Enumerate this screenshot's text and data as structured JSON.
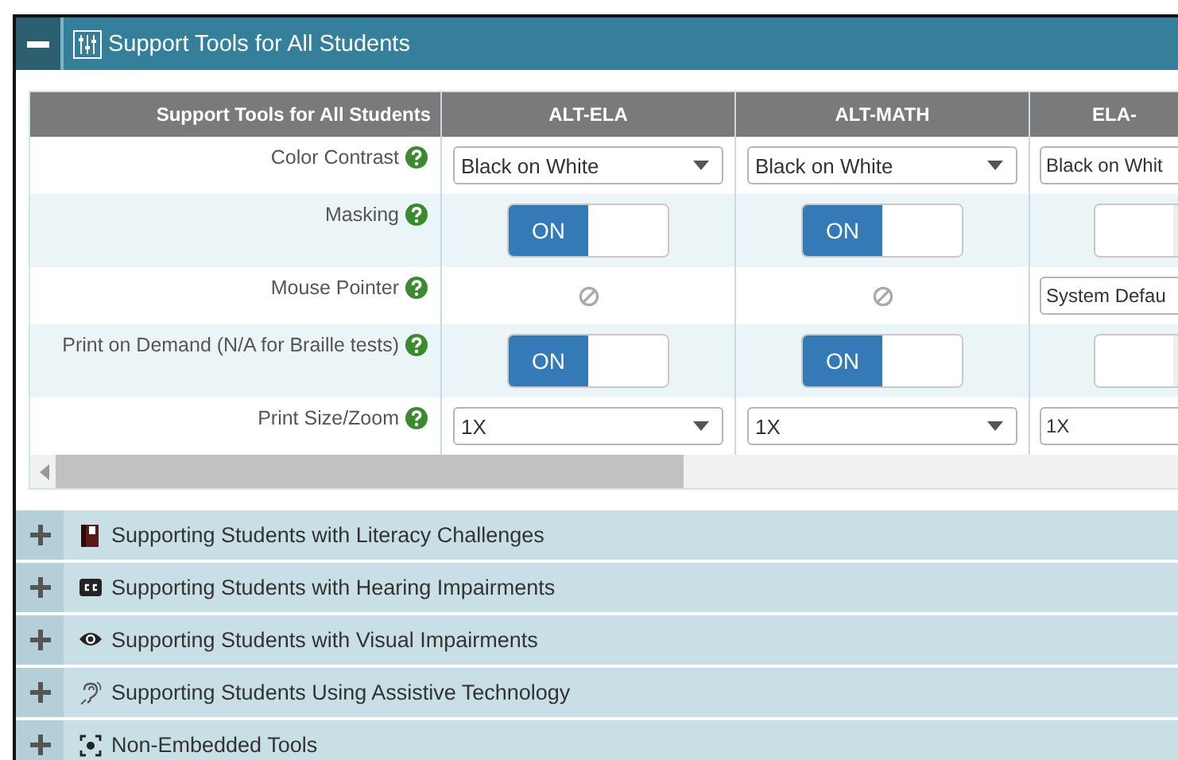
{
  "panel": {
    "title": "Support Tools for All Students",
    "expanded": true
  },
  "table": {
    "columns": [
      "Support Tools for All Students",
      "ALT-ELA",
      "ALT-MATH",
      "ELA-"
    ],
    "rows": [
      {
        "cells": [
          {
            "kind": "label",
            "text": "Color Contrast"
          },
          {
            "kind": "select",
            "value": "Black on White"
          },
          {
            "kind": "select",
            "value": "Black on White"
          },
          {
            "kind": "select",
            "value": "Black on Whit"
          }
        ]
      },
      {
        "cells": [
          {
            "kind": "label",
            "text": "Masking"
          },
          {
            "kind": "toggle",
            "on": true,
            "label": "ON"
          },
          {
            "kind": "toggle",
            "on": true,
            "label": "ON"
          },
          {
            "kind": "toggle",
            "on": false
          }
        ]
      },
      {
        "cells": [
          {
            "kind": "label",
            "text": "Mouse Pointer"
          },
          {
            "kind": "unavailable"
          },
          {
            "kind": "unavailable"
          },
          {
            "kind": "select",
            "value": "System Defau"
          }
        ]
      },
      {
        "cells": [
          {
            "kind": "label",
            "text": "Print on Demand (N/A for Braille tests)"
          },
          {
            "kind": "toggle",
            "on": true,
            "label": "ON"
          },
          {
            "kind": "toggle",
            "on": true,
            "label": "ON"
          },
          {
            "kind": "toggle",
            "on": false
          }
        ]
      },
      {
        "cells": [
          {
            "kind": "label",
            "text": "Print Size/Zoom"
          },
          {
            "kind": "select",
            "value": "1X"
          },
          {
            "kind": "select",
            "value": "1X"
          },
          {
            "kind": "select",
            "value": "1X"
          }
        ]
      }
    ]
  },
  "sections": [
    {
      "title": "Supporting Students with Literacy Challenges",
      "expanded": false
    },
    {
      "title": "Supporting Students with Hearing Impairments",
      "expanded": false
    },
    {
      "title": "Supporting Students with Visual Impairments",
      "expanded": false
    },
    {
      "title": "Supporting Students Using Assistive Technology",
      "expanded": false
    },
    {
      "title": "Non-Embedded Tools",
      "expanded": false
    }
  ]
}
